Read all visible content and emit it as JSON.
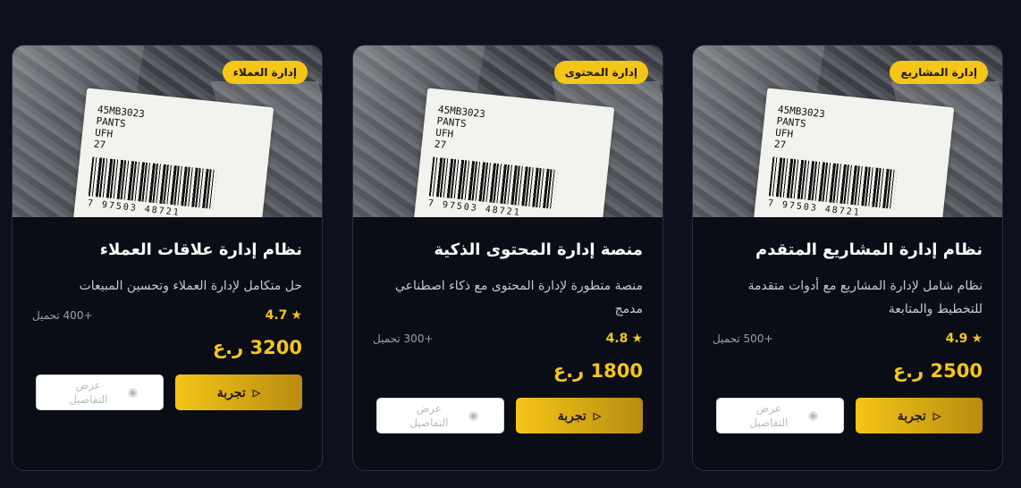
{
  "products": [
    {
      "badge": "إدارة المشاريع",
      "title": "نظام إدارة المشاريع المتقدم",
      "description": "نظام شامل لإدارة المشاريع مع أدوات متقدمة للتخطيط والمتابعة",
      "rating": "4.9",
      "downloads": "+500 تحميل",
      "price": "2500 ر.ع",
      "try_label": "تجربة",
      "view_label": "عرض التفاصيل"
    },
    {
      "badge": "إدارة المحتوى",
      "title": "منصة إدارة المحتوى الذكية",
      "description": "منصة متطورة لإدارة المحتوى مع ذكاء اصطناعي مدمج",
      "rating": "4.8",
      "downloads": "+300 تحميل",
      "price": "1800 ر.ع",
      "try_label": "تجربة",
      "view_label": "عرض التفاصيل"
    },
    {
      "badge": "إدارة العملاء",
      "title": "نظام إدارة علاقات العملاء",
      "description": "حل متكامل لإدارة العملاء وتحسين المبيعات",
      "rating": "4.7",
      "downloads": "+400 تحميل",
      "price": "3200 ر.ع",
      "try_label": "تجربة",
      "view_label": "عرض التفاصيل"
    }
  ],
  "image_label": {
    "line1": "45MB3023",
    "line2": "PANTS",
    "line3": "UFH",
    "line4": "27",
    "barcode_number": "7 97503 48721"
  },
  "colors": {
    "accent": "#f5c518",
    "background": "#0c111d",
    "card": "#0a0d16"
  }
}
